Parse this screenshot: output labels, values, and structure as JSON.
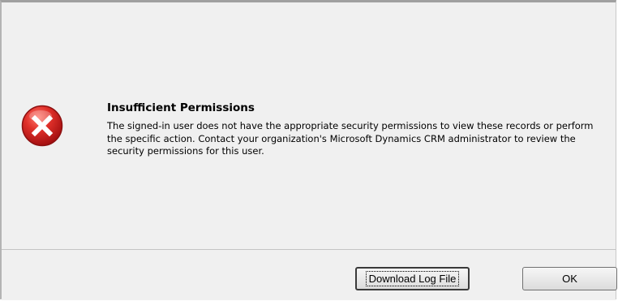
{
  "dialog": {
    "title": "Insufficient Permissions",
    "message": "The signed-in user does not have the appropriate security permissions to view these records or perform the specific action. Contact your organization's Microsoft Dynamics CRM administrator to review the security permissions for this user.",
    "icon": "error-x-icon"
  },
  "buttons": {
    "download_label": "Download Log File",
    "ok_label": "OK"
  },
  "colors": {
    "icon_red": "#d42a2a",
    "background": "#f0f0f0"
  }
}
